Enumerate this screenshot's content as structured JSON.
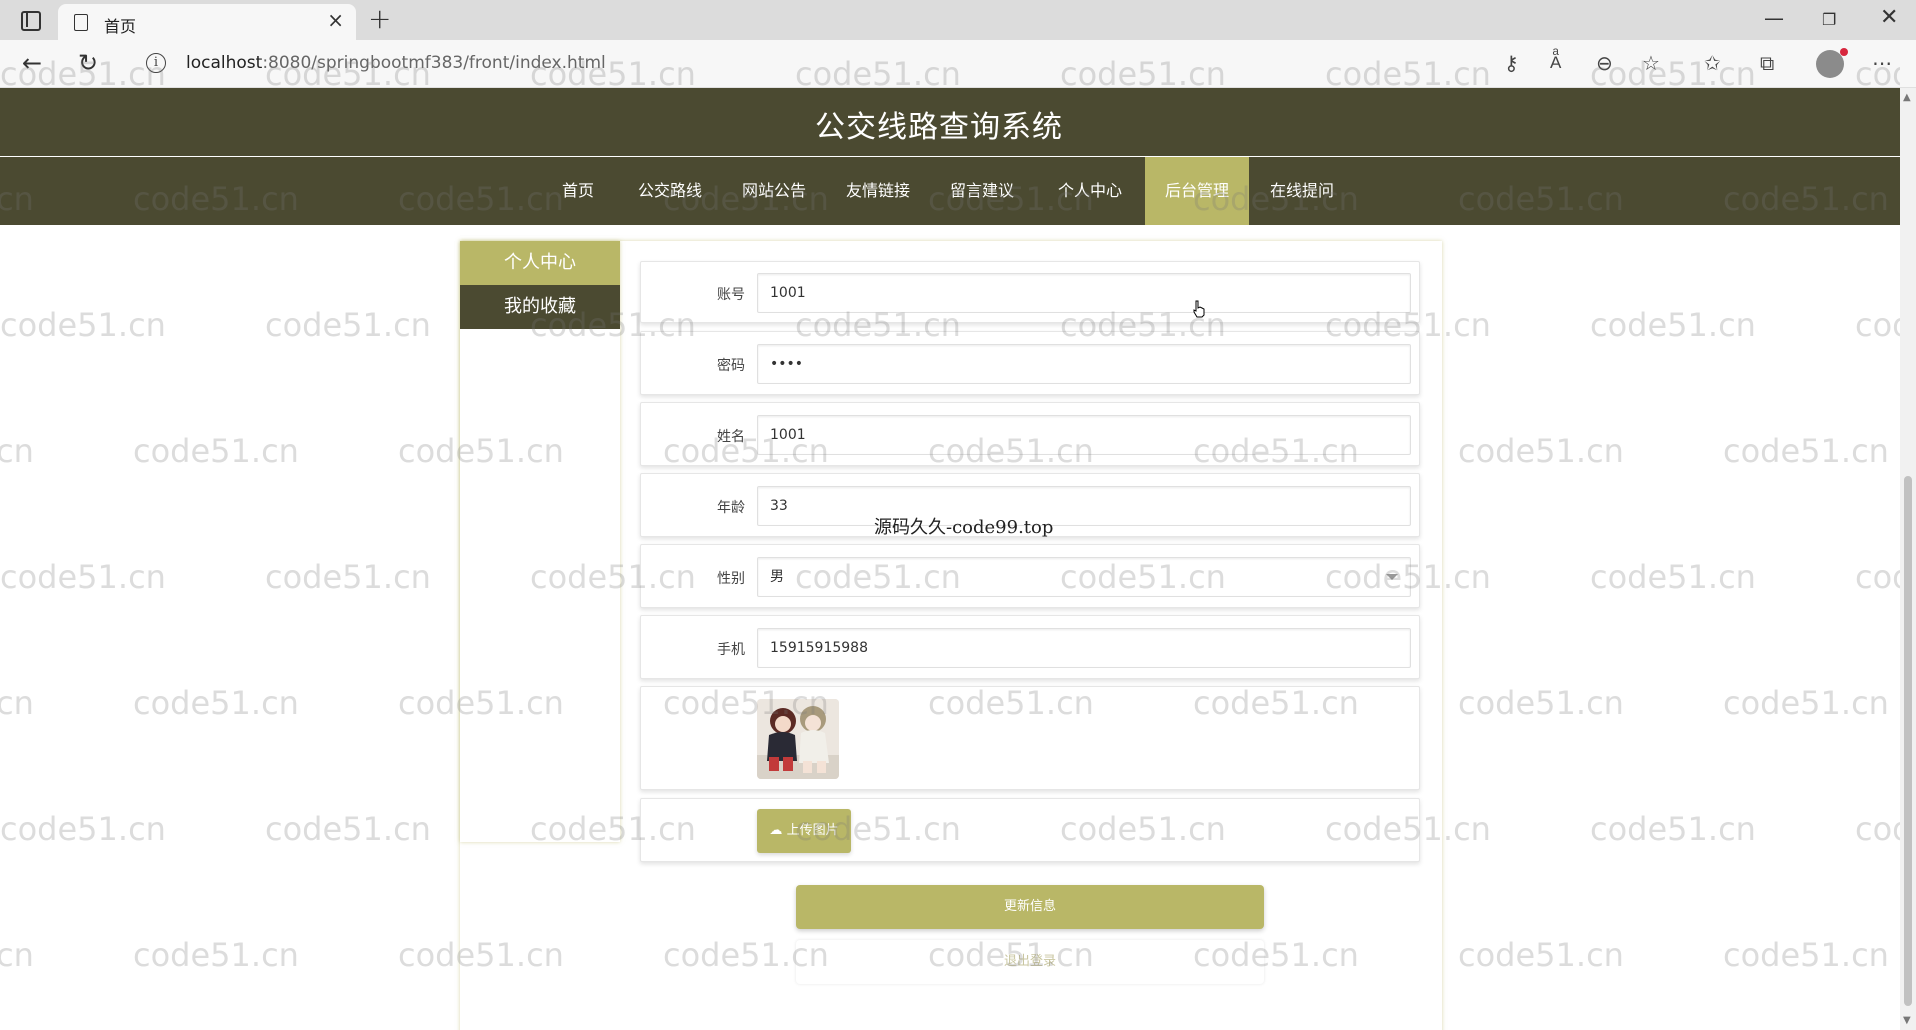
{
  "browser": {
    "tab_title": "首页",
    "url_host": "localhost",
    "url_path": ":8080/springbootmf383/front/index.html"
  },
  "site": {
    "title": "公交线路查询系统",
    "nav": [
      "首页",
      "公交路线",
      "网站公告",
      "友情链接",
      "留言建议",
      "个人中心",
      "后台管理",
      "在线提问"
    ],
    "active_nav": "后台管理"
  },
  "sidebar": {
    "items": [
      "个人中心",
      "我的收藏"
    ]
  },
  "form": {
    "account": {
      "label": "账号",
      "value": "1001"
    },
    "password": {
      "label": "密码",
      "value": "••••"
    },
    "name": {
      "label": "姓名",
      "value": "1001"
    },
    "age": {
      "label": "年龄",
      "value": "33"
    },
    "gender": {
      "label": "性别",
      "value": "男"
    },
    "phone": {
      "label": "手机",
      "value": "15915915988"
    },
    "upload_label": "上传图片"
  },
  "buttons": {
    "update": "更新信息",
    "logout": "退出登录"
  },
  "overlay_text": "源码久久-code99.top",
  "watermark_text": "code51.cn"
}
